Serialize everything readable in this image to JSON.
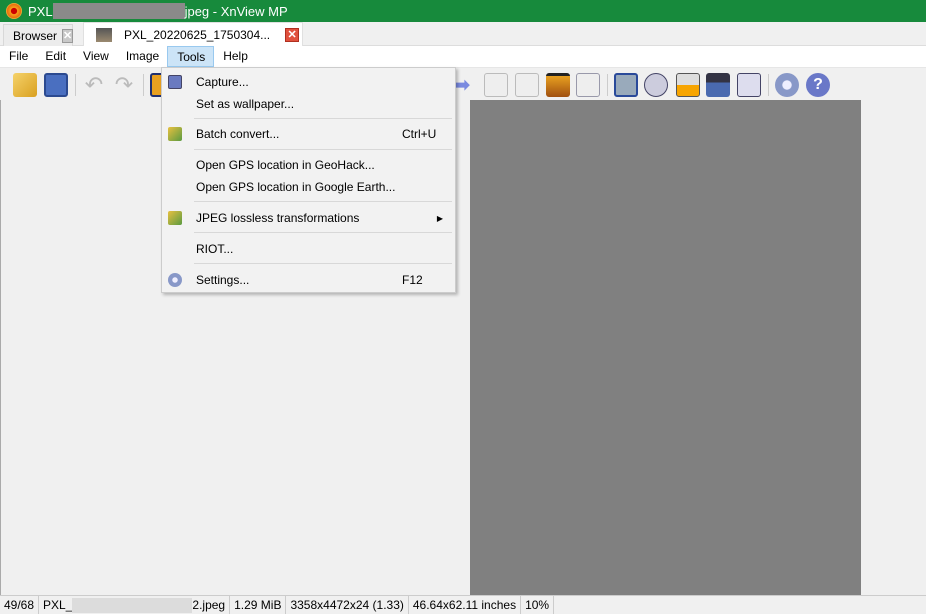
{
  "window": {
    "title_prefix": "PXL",
    "title_suffix": "jpeg - XnView MP"
  },
  "tabs": [
    {
      "label": "Browser",
      "close": "✕"
    },
    {
      "label": "PXL_20220625_1750304...",
      "close": "✕"
    }
  ],
  "menubar": [
    "File",
    "Edit",
    "View",
    "Image",
    "Tools",
    "Help"
  ],
  "tools_menu": {
    "items": [
      {
        "label": "Capture...",
        "shortcut": "",
        "icon": "camera-icon"
      },
      {
        "label": "Set as wallpaper...",
        "shortcut": ""
      },
      {
        "label": "Batch convert...",
        "shortcut": "Ctrl+U",
        "icon": "batch-convert-icon"
      },
      {
        "label": "Open GPS location in GeoHack...",
        "shortcut": ""
      },
      {
        "label": "Open GPS location in Google Earth...",
        "shortcut": ""
      },
      {
        "label": "JPEG lossless transformations",
        "shortcut": "",
        "submenu": "▶",
        "icon": "jpeg-transform-icon"
      },
      {
        "label": "RIOT...",
        "shortcut": ""
      },
      {
        "label": "Settings...",
        "shortcut": "F12",
        "icon": "gear-icon"
      }
    ]
  },
  "status": {
    "index": "49/68",
    "file_prefix": "PXL_",
    "file_suffix": "2.jpeg",
    "size": "1.29 MiB",
    "dimensions": "3358x4472x24 (1.33)",
    "print_size": "46.64x62.11 inches",
    "zoom": "10%"
  },
  "colors": {
    "titlebar": "#178a3c",
    "image_bg": "#808080"
  }
}
